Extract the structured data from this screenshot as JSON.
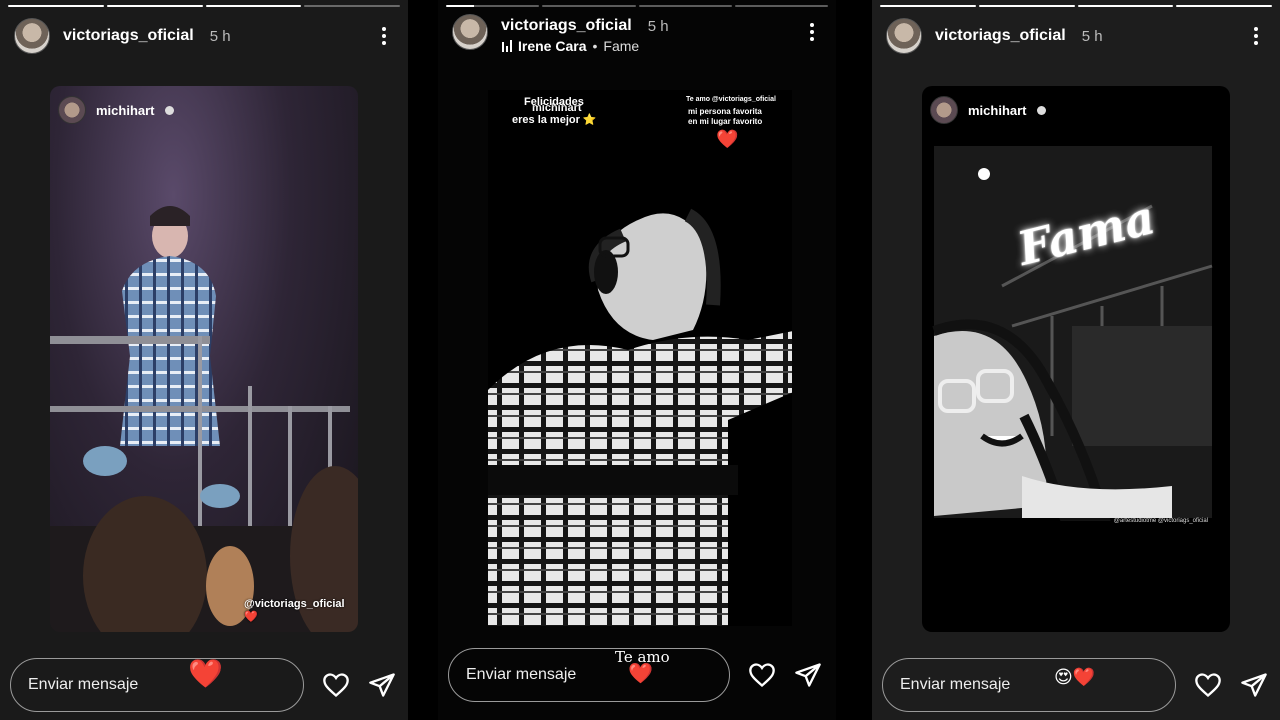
{
  "panels": [
    {
      "username": "victoriags_oficial",
      "time": "5 h",
      "card_user": "michihart",
      "mention": "@victoriags_oficial ❤️",
      "message_placeholder": "Enviar mensaje",
      "sticker": "❤️"
    },
    {
      "username": "victoriags_oficial",
      "time": "5 h",
      "music_artist": "Irene Cara",
      "music_title": "Fame",
      "music_sep": "•",
      "overlay_left_1": "michihart",
      "overlay_left_2": "Felicidades",
      "overlay_left_3": "eres la mejor ⭐",
      "overlay_right_1": "Te amo @victoriags_oficial",
      "overlay_right_2": "mi persona favorita",
      "overlay_right_3": "en mi lugar favorito",
      "overlay_heart": "❤️",
      "message_placeholder": "Enviar mensaje",
      "sticker_text": "Te amo",
      "sticker": "❤️"
    },
    {
      "username": "victoriags_oficial",
      "time": "5 h",
      "card_user": "michihart",
      "sign_text": "Fama",
      "caption": "@artestudiotme @victoriags_oficial",
      "message_placeholder": "Enviar mensaje",
      "sticker": "😍❤️"
    }
  ],
  "colors": {
    "heart_red": "#e0242b",
    "border": "#9a9a9a"
  },
  "icons": [
    "more-options-icon",
    "heart-icon",
    "send-icon",
    "verified-icon",
    "music-icon"
  ]
}
